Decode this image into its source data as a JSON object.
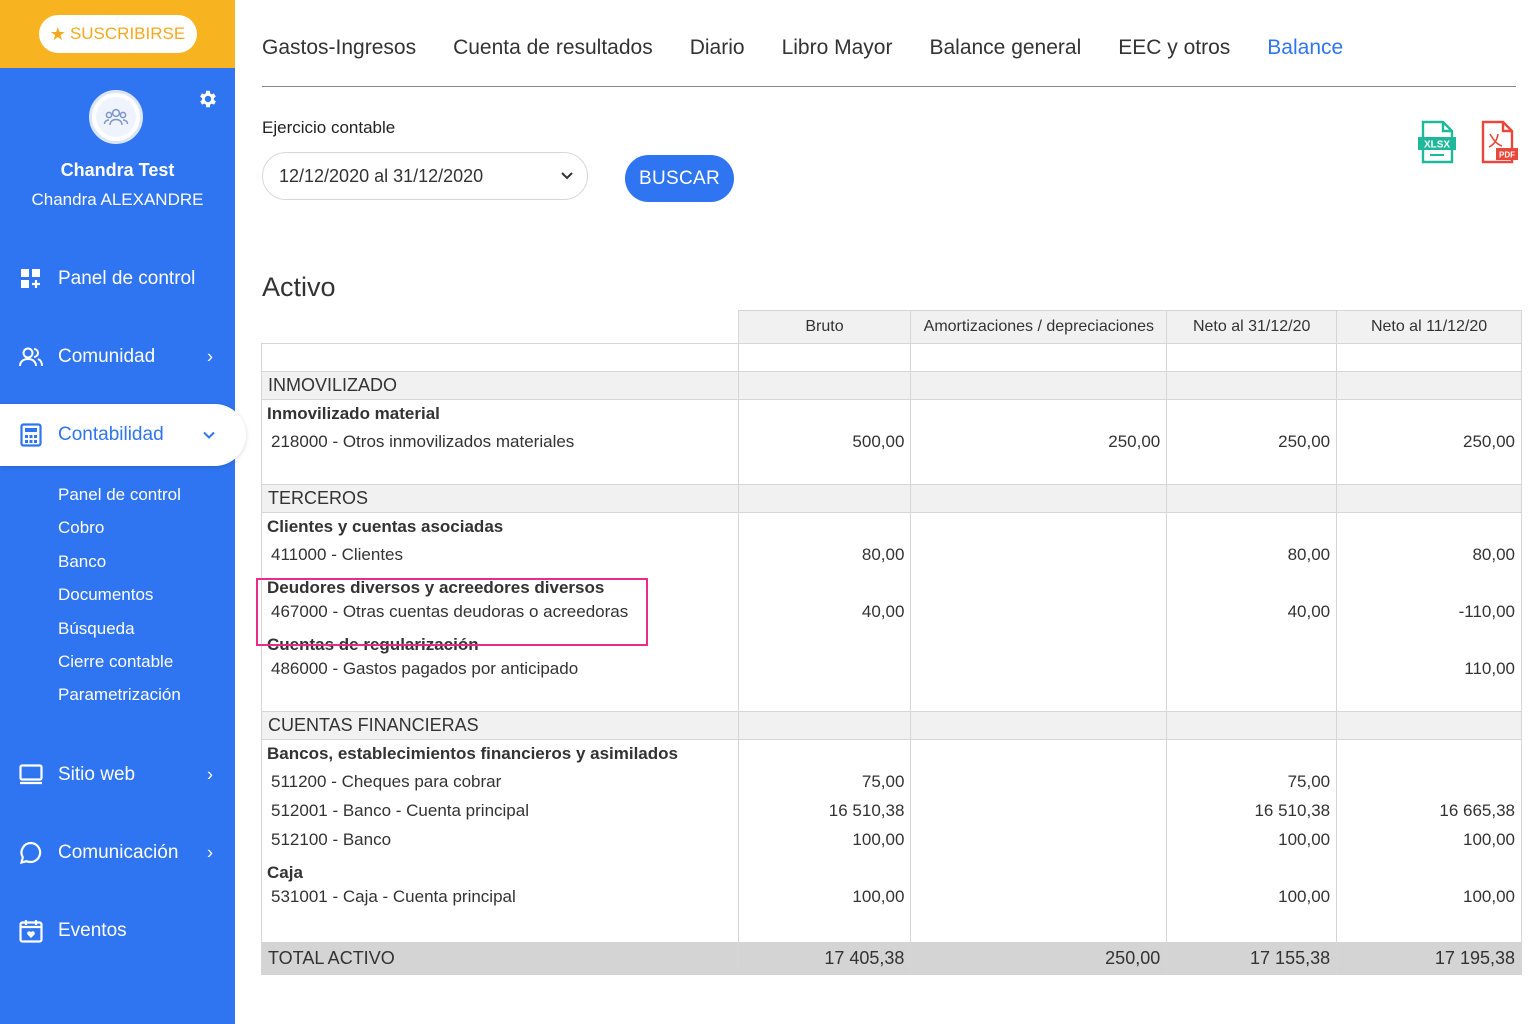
{
  "sidebar": {
    "subscribe_label": "SUSCRIBIRSE",
    "profile_name": "Chandra Test",
    "profile_sub": "Chandra ALEXANDRE",
    "nav": {
      "panel": "Panel de control",
      "comunidad": "Comunidad",
      "contabilidad": "Contabilidad",
      "sitio": "Sitio web",
      "comunicacion": "Comunicación",
      "eventos": "Eventos"
    },
    "submenu": [
      "Panel de control",
      "Cobro",
      "Banco",
      "Documentos",
      "Búsqueda",
      "Cierre contable",
      "Parametrización"
    ]
  },
  "tabs": [
    "Gastos-Ingresos",
    "Cuenta de resultados",
    "Diario",
    "Libro Mayor",
    "Balance general",
    "EEC y otros",
    "Balance"
  ],
  "filter": {
    "label": "Ejercicio contable",
    "selected": "12/12/2020 al 31/12/2020",
    "search_button": "BUSCAR"
  },
  "exports": {
    "xlsx": "XLSX",
    "pdf": "PDF"
  },
  "section_title": "Activo",
  "table": {
    "headers": [
      "Bruto",
      "Amortizaciones / depreciaciones",
      "Neto al 31/12/20",
      "Neto al 11/12/20"
    ],
    "groups": {
      "inmovilizado": "INMOVILIZADO",
      "terceros": "TERCEROS",
      "financieras": "CUENTAS FINANCIERAS"
    },
    "subs": {
      "inmov_material": "Inmovilizado material",
      "clientes": "Clientes y cuentas asociadas",
      "deudores": "Deudores diversos y acreedores diversos",
      "regularizacion": "Cuentas de regularización",
      "bancos": "Bancos, establecimientos financieros y asimilados",
      "caja": "Caja"
    },
    "rows": {
      "r218000": {
        "label": "218000 - Otros inmovilizados materiales",
        "bruto": "500,00",
        "amort": "250,00",
        "neto1": "250,00",
        "neto2": "250,00"
      },
      "r411000": {
        "label": "411000 - Clientes",
        "bruto": "80,00",
        "amort": "",
        "neto1": "80,00",
        "neto2": "80,00"
      },
      "r467000": {
        "label": "467000 - Otras cuentas deudoras o acreedoras",
        "bruto": "40,00",
        "amort": "",
        "neto1": "40,00",
        "neto2": "-110,00"
      },
      "r486000": {
        "label": "486000 - Gastos pagados por anticipado",
        "bruto": "",
        "amort": "",
        "neto1": "",
        "neto2": "110,00"
      },
      "r511200": {
        "label": "511200 - Cheques para cobrar",
        "bruto": "75,00",
        "amort": "",
        "neto1": "75,00",
        "neto2": ""
      },
      "r512001": {
        "label": "512001 - Banco - Cuenta principal",
        "bruto": "16 510,38",
        "amort": "",
        "neto1": "16 510,38",
        "neto2": "16 665,38"
      },
      "r512100": {
        "label": "512100 - Banco",
        "bruto": "100,00",
        "amort": "",
        "neto1": "100,00",
        "neto2": "100,00"
      },
      "r531001": {
        "label": "531001 - Caja - Cuenta principal",
        "bruto": "100,00",
        "amort": "",
        "neto1": "100,00",
        "neto2": "100,00"
      }
    },
    "total": {
      "label": "TOTAL ACTIVO",
      "bruto": "17 405,38",
      "amort": "250,00",
      "neto1": "17 155,38",
      "neto2": "17 195,38"
    }
  },
  "colors": {
    "primary": "#2f74f0",
    "subscribe": "#f8b320",
    "highlight": "#ea2b8c",
    "xlsx": "#1fb89a",
    "pdf": "#e8483b"
  }
}
